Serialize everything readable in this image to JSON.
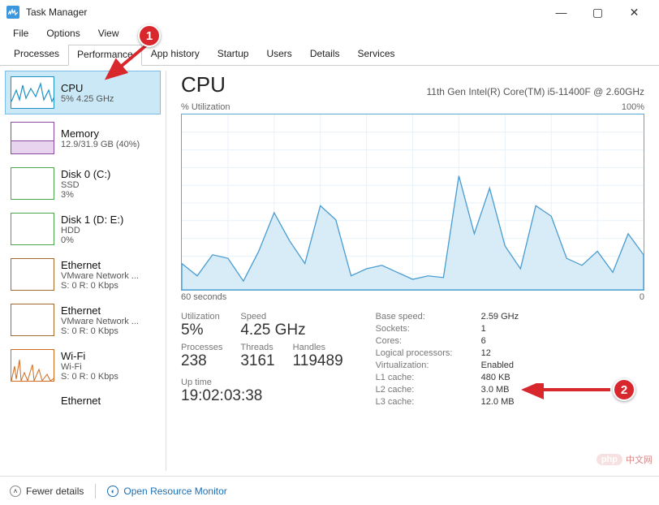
{
  "window": {
    "title": "Task Manager",
    "controls": {
      "min": "—",
      "max": "▢",
      "close": "✕"
    }
  },
  "menu": {
    "file": "File",
    "options": "Options",
    "view": "View"
  },
  "tabs": {
    "processes": "Processes",
    "performance": "Performance",
    "app_history": "App history",
    "startup": "Startup",
    "users": "Users",
    "details": "Details",
    "services": "Services"
  },
  "sidebar": [
    {
      "title": "CPU",
      "sub": "5% 4.25 GHz"
    },
    {
      "title": "Memory",
      "sub": "12.9/31.9 GB (40%)"
    },
    {
      "title": "Disk 0 (C:)",
      "sub1": "SSD",
      "sub2": "3%"
    },
    {
      "title": "Disk 1 (D: E:)",
      "sub1": "HDD",
      "sub2": "0%"
    },
    {
      "title": "Ethernet",
      "sub1": "VMware Network ...",
      "sub2": "S: 0 R: 0 Kbps"
    },
    {
      "title": "Ethernet",
      "sub1": "VMware Network ...",
      "sub2": "S: 0 R: 0 Kbps"
    },
    {
      "title": "Wi-Fi",
      "sub1": "Wi-Fi",
      "sub2": "S: 0 R: 0 Kbps"
    },
    {
      "title": "Ethernet",
      "sub1": "",
      "sub2": ""
    }
  ],
  "main": {
    "title": "CPU",
    "subtitle": "11th Gen Intel(R) Core(TM) i5-11400F @ 2.60GHz",
    "chart_top_left": "% Utilization",
    "chart_top_right": "100%",
    "chart_bottom_left": "60 seconds",
    "chart_bottom_right": "0"
  },
  "stats_left": {
    "utilization_label": "Utilization",
    "utilization_value": "5%",
    "speed_label": "Speed",
    "speed_value": "4.25 GHz",
    "processes_label": "Processes",
    "processes_value": "238",
    "threads_label": "Threads",
    "threads_value": "3161",
    "handles_label": "Handles",
    "handles_value": "119489",
    "uptime_label": "Up time",
    "uptime_value": "19:02:03:38"
  },
  "stats_right": {
    "base_speed_l": "Base speed:",
    "base_speed_v": "2.59 GHz",
    "sockets_l": "Sockets:",
    "sockets_v": "1",
    "cores_l": "Cores:",
    "cores_v": "6",
    "lp_l": "Logical processors:",
    "lp_v": "12",
    "virt_l": "Virtualization:",
    "virt_v": "Enabled",
    "l1_l": "L1 cache:",
    "l1_v": "480 KB",
    "l2_l": "L2 cache:",
    "l2_v": "3.0 MB",
    "l3_l": "L3 cache:",
    "l3_v": "12.0 MB"
  },
  "bottom": {
    "fewer": "Fewer details",
    "orm": "Open Resource Monitor"
  },
  "annotations": {
    "badge1": "1",
    "badge2": "2"
  },
  "watermark": {
    "brand": "php",
    "text": "中文网"
  },
  "chart_data": {
    "type": "area",
    "title": "% Utilization",
    "xlabel": "60 seconds",
    "ylabel": "% Utilization",
    "xlim": [
      60,
      0
    ],
    "ylim": [
      0,
      100
    ],
    "x": [
      60,
      58,
      56,
      54,
      52,
      50,
      48,
      46,
      44,
      42,
      40,
      38,
      36,
      34,
      32,
      30,
      28,
      26,
      24,
      22,
      20,
      18,
      16,
      14,
      12,
      10,
      8,
      6,
      4,
      2,
      0
    ],
    "values": [
      15,
      8,
      20,
      18,
      5,
      22,
      44,
      28,
      15,
      48,
      40,
      8,
      12,
      14,
      10,
      6,
      8,
      7,
      65,
      32,
      58,
      25,
      12,
      48,
      42,
      18,
      14,
      22,
      10,
      32,
      20
    ]
  }
}
